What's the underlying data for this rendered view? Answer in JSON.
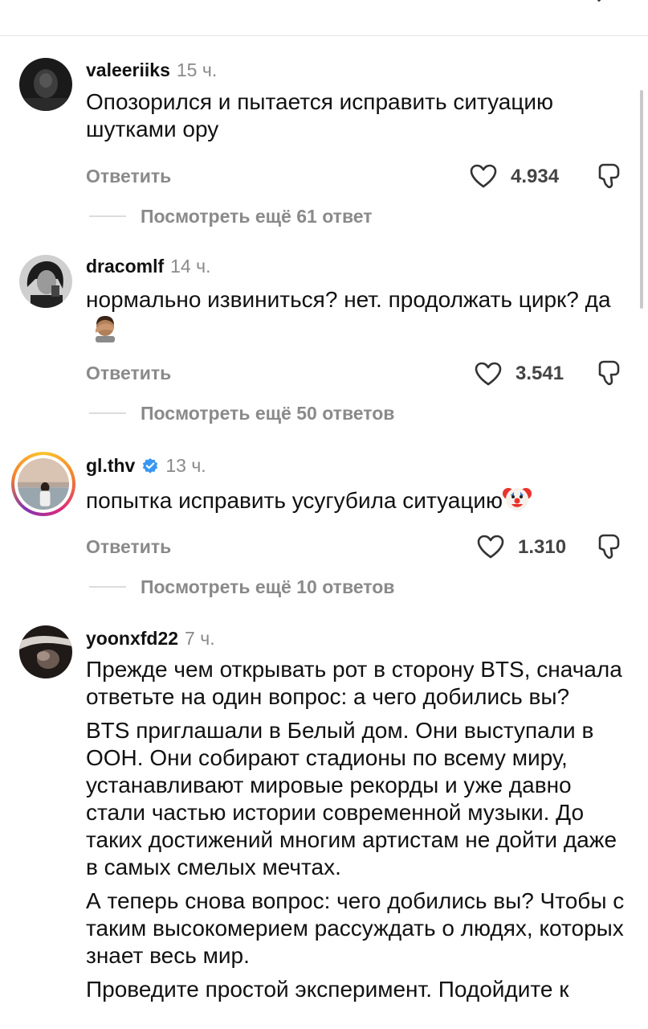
{
  "comments": [
    {
      "username": "valeeriiks",
      "time": "15 ч.",
      "text": [
        "Опозорился и пытается исправить ситуацию шутками ору"
      ],
      "reply_label": "Ответить",
      "likes": "4.934",
      "more_replies": "Посмотреть ещё 61 ответ"
    },
    {
      "username": "dracomlf",
      "time": "14 ч.",
      "text": [
        "нормально извиниться? нет. продолжать цирк? да"
      ],
      "reply_label": "Ответить",
      "likes": "3.541",
      "more_replies": "Посмотреть ещё 50 ответов"
    },
    {
      "username": "gl.thv",
      "time": "13 ч.",
      "text": [
        "попытка исправить усугубила ситуацию"
      ],
      "reply_label": "Ответить",
      "likes": "1.310",
      "more_replies": "Посмотреть ещё 10 ответов"
    },
    {
      "username": "yoonxfd22",
      "time": "7 ч.",
      "text": [
        "Прежде чем открывать рот в сторону BTS, сначала ответьте на один вопрос: а чего добились вы?",
        "BTS приглашали в Белый дом. Они выступали в ООН. Они собирают стадионы по всему миру, устанавливают мировые рекорды и уже давно стали частью истории современной музыки. До таких достижений многим артистам не дойти даже в самых смелых мечтах.",
        "А теперь снова вопрос: чего добились вы? Чтобы с таким высокомерием рассуждать о людях, которых знает весь мир.",
        "Проведите простой эксперимент. Подойдите к"
      ]
    }
  ],
  "colors": {
    "secondary_text": "#8a8a8a",
    "verified_blue": "#3897f0"
  }
}
